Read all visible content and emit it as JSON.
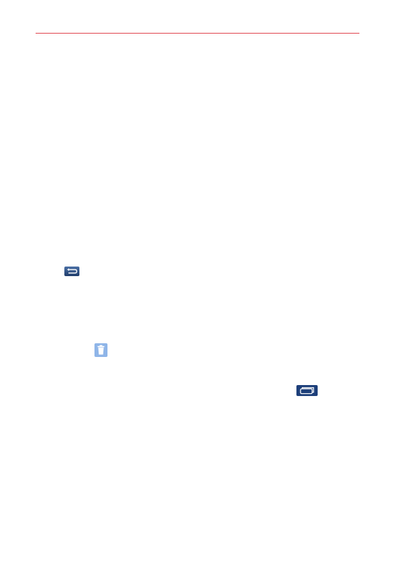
{
  "colors": {
    "header_rule": "#e0404a",
    "back_icon_fill": "#2d5287",
    "trash_icon_fill": "#8fb5e8",
    "recent_apps_icon_fill": "#1d3f7a"
  },
  "icons": {
    "back": "back-arrow-icon",
    "trash": "trash-icon",
    "recent_apps": "recent-apps-icon"
  }
}
